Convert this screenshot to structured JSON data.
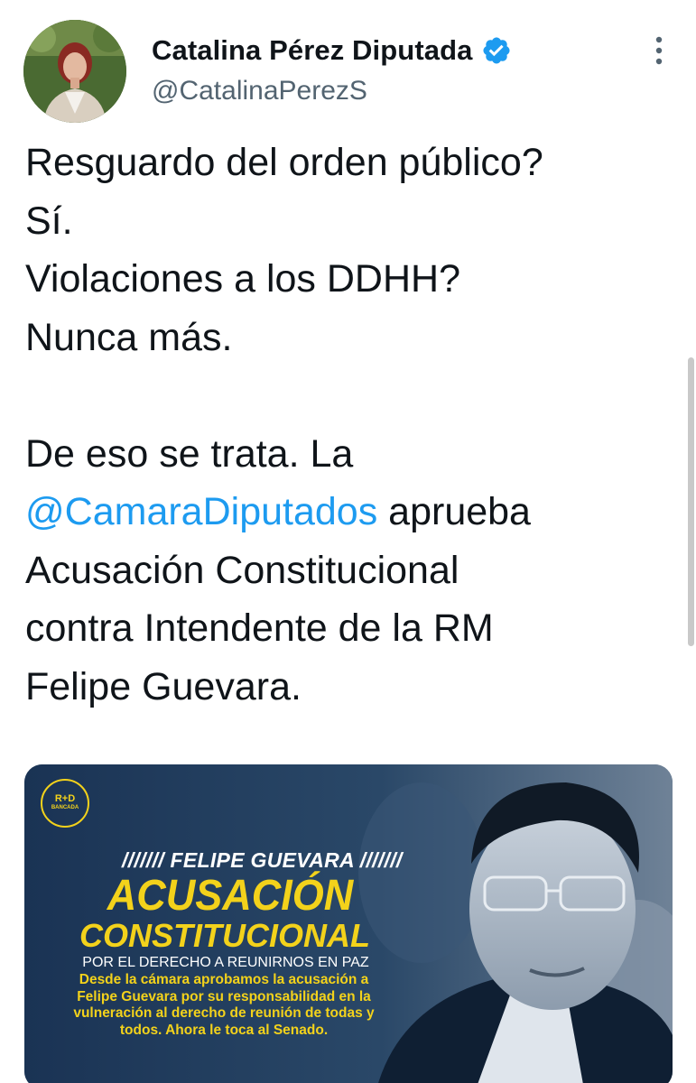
{
  "tweet": {
    "author": {
      "display_name": "Catalina Pérez Diputada",
      "handle": "@CatalinaPerezS",
      "verified": true,
      "avatar_icon": "profile-photo"
    },
    "more_icon": "more-vertical-icon",
    "text_lines": [
      "Resguardo del orden público?",
      "Sí.",
      "Violaciones a los DDHH?",
      "Nunca más.",
      "",
      "De eso se trata. La"
    ],
    "mention": "@CamaraDiputados",
    "mention_suffix": " aprueba",
    "text_lines_after": [
      "Acusación Constitucional",
      "contra Intendente de la RM",
      "Felipe Guevara."
    ],
    "media": {
      "badge_top": "R+D",
      "badge_bottom": "BANCADA",
      "kicker": "/////// FELIPE GUEVARA ///////",
      "title_line1": "ACUSACIÓN",
      "title_line2": "CONSTITUCIONAL",
      "subtitle": "POR EL DERECHO A REUNIRNOS EN PAZ",
      "body_lines": [
        "Desde la cámara aprobamos la acusación a",
        "Felipe Guevara por su responsabilidad en la",
        "vulneración al derecho de reunión de todas y",
        "todos. Ahora le toca al Senado."
      ]
    }
  },
  "colors": {
    "text": "#0f1419",
    "secondary": "#536471",
    "link": "#1d9bf0",
    "verified": "#1d9bf0",
    "poster_yellow": "#f3d21b",
    "poster_blue": "#1f3a5a"
  }
}
